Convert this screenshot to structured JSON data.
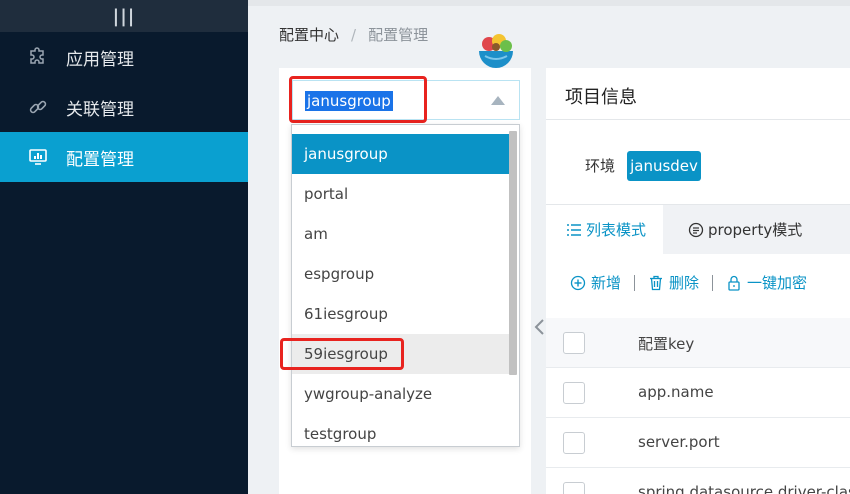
{
  "sidebar": {
    "collapse_glyph": "|||",
    "items": [
      {
        "label": "应用管理",
        "icon": "puzzle-icon"
      },
      {
        "label": "关联管理",
        "icon": "link-icon"
      },
      {
        "label": "配置管理",
        "icon": "monitor-icon"
      }
    ],
    "active_index": 2
  },
  "breadcrumb": {
    "root": "配置中心",
    "separator": "/",
    "current": "配置管理"
  },
  "group_select": {
    "value": "janusgroup",
    "options": [
      "janusgroup",
      "portal",
      "am",
      "espgroup",
      "61iesgroup",
      "59iesgroup",
      "ywgroup-analyze",
      "testgroup"
    ],
    "selected_index": 0,
    "hover_index": 5
  },
  "project": {
    "title": "项目信息",
    "env_label": "环境",
    "env_value": "janusdev"
  },
  "tabs": [
    {
      "label": "列表模式"
    },
    {
      "label": "property模式"
    }
  ],
  "toolbar": {
    "add": "新增",
    "delete": "删除",
    "encrypt": "一键加密"
  },
  "table": {
    "header": "配置key",
    "rows": [
      "app.name",
      "server.port",
      "spring.datasource.driver-class-na"
    ]
  },
  "colors": {
    "sidebar_bg": "#091a2d",
    "accent": "#0aa0d0",
    "highlight_red": "#e8231f"
  }
}
